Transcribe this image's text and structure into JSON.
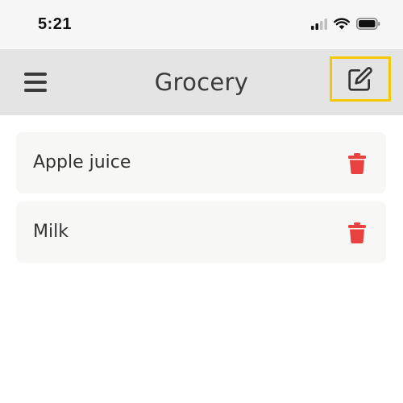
{
  "status_bar": {
    "time": "5:21",
    "icons": [
      "signal-icon",
      "wifi-icon",
      "battery-icon"
    ]
  },
  "header": {
    "title": "Grocery",
    "menu_icon": "hamburger-menu-icon",
    "edit_icon": "edit-icon",
    "highlight_color": "#f2c800"
  },
  "list": {
    "items": [
      {
        "label": "Apple juice",
        "delete_icon": "trash-icon"
      },
      {
        "label": "Milk",
        "delete_icon": "trash-icon"
      }
    ],
    "delete_color": "#e94040"
  }
}
